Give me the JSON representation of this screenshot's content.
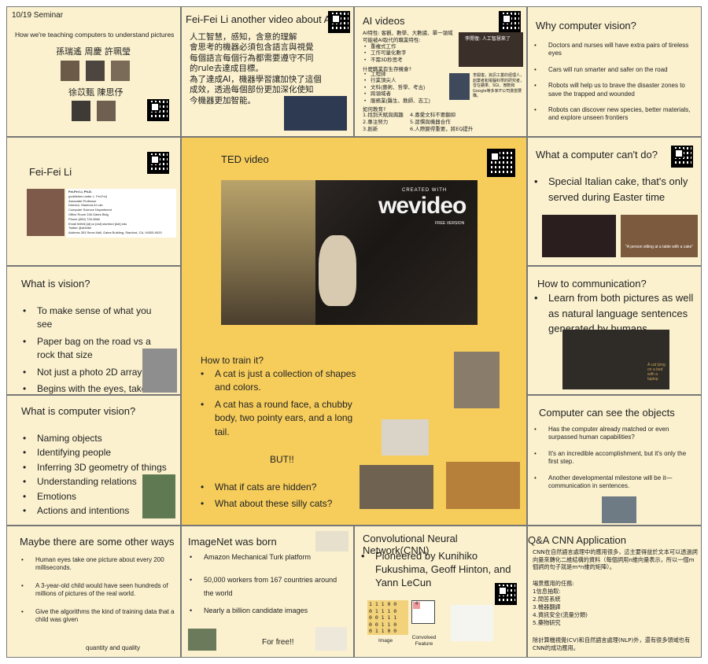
{
  "seminar": {
    "date": "10/19 Seminar",
    "subtitle": "How we're teaching computers to understand pictures",
    "row1": "孫瑞遙  周慶  許珮瑩",
    "row2": "徐苡甄  陳思伃"
  },
  "feifei_video": {
    "title": "Fei-Fei Li another video about AI",
    "text": "人工智慧，感知，含意的理解\n會思考的機器必須包含語言與視覺\n每個語言每個行為都需要遵守不同\n的rule去達成目標。\n為了達成AI，機器學習讓加快了這個\n成效，透過每個部份更加深化使知\n今機器更加智能。"
  },
  "ai_videos": {
    "title": "AI videos",
    "intro": "AI特性: 客觀、數學、大數據、單一領域\n可能被AI取代的職業特性:",
    "list1": [
      "重複式工作",
      "工作可量化數字",
      "不需3D秒思考"
    ],
    "q2": "什麼職業有生存機會?",
    "list2": [
      "工程師",
      "行業頂尖人",
      "文科(藝術、哲學、考古)",
      "跨領域者",
      "服務業(醫生、教師、志工)"
    ],
    "q3": "如何教育?",
    "edu_left": "1.找到天賦與興趣\n2.專注努力\n3.創新",
    "edu_right": "4.喜愛文科不要翻抑\n5.習慣與機器合作\n6.人際變得重要，將EQ提升",
    "caption": "李開復，資訊工業的經理人，創業者和電腦科學的研究者，曾在蘋果、SGI、微軟和Google等多家IT公司擔當要職。",
    "video_title": "李開復: 人工智慧來了"
  },
  "why_cv": {
    "title": "Why computer vision?",
    "items": [
      "Doctors and nurses will have extra pairs of tireless eyes",
      "Cars will run smarter and safer on the road",
      "Robots will help us to brave the disaster zones to save the trapped and wounded",
      "Robots can discover new species, better materials, and explore unseen frontiers"
    ]
  },
  "feifei_li": {
    "title": "Fei-Fei Li",
    "card_rows": [
      "Fei-Fei Li, Ph.D.",
      "(publishes under L. Fei-Fei)",
      "Associate Professor",
      "Director, Stanford AI Lab",
      "Computer Science Department",
      "Office     Room 246 Gates Bldg",
      "Phone      (650) 725-3860",
      "Email      feifeili [at] cs [dot] stanford [dot] edu",
      "Twitter    @drfeifei",
      "Address    353 Serra Mall, Gates Building, Stanford, CA, 94305-9020"
    ]
  },
  "ted": {
    "title": "TED video",
    "watermark": "wevideo",
    "watermark_top": "CREATED WITH",
    "watermark_bottom": "FREE VERSION",
    "train_title": "How to train it?",
    "train_items": [
      "A cat is just a collection of shapes and colors.",
      "A cat has a round face, a chubby body, two pointy ears, and a long tail."
    ],
    "but": "BUT!!",
    "what_items": [
      "What if cats are hidden?",
      "What about these silly cats?"
    ]
  },
  "cant_do": {
    "title": "What a computer can't do?",
    "items": [
      "Special Italian cake, that's only served during Easter time"
    ],
    "caption": "\"A person sitting at a table with a cake\""
  },
  "what_vision": {
    "title": "What is vision?",
    "items": [
      "To make sense of what you see",
      "Paper bag on the road vs a rock that size",
      "Not just a photo 2D array",
      "Begins with the eyes, take place in the brain"
    ]
  },
  "how_comm": {
    "title": "How to communication?",
    "items": [
      "Learn from both pictures as well as natural language sentences generated by humans."
    ],
    "caption": "A cat lying on a bed with a laptop"
  },
  "what_cv": {
    "title": "What is computer vision?",
    "items": [
      "Naming objects",
      "Identifying people",
      "Inferring 3D geometry of things",
      "Understanding relations",
      "Emotions",
      "Actions and intentions"
    ]
  },
  "see_objects": {
    "title": "Computer can see the objects",
    "items": [
      "Has the computer already matched or even surpassed human capabilities?",
      "It's an incredible accomplishment, but it's only the first step.",
      "Another developmental milestone will be it—communication in sentences."
    ]
  },
  "other_ways": {
    "title": "Maybe there are some other ways",
    "items": [
      "Human eyes take one picture about every 200 milliseconds.",
      "A 3-year-old child would have seen hundreds of millions of pictures of the real world.",
      "Give the algorithms the kind of training data that a child was given"
    ],
    "tail": "quantity and quality"
  },
  "imagenet": {
    "title": "ImageNet was born",
    "items": [
      "Amazon Mechanical Turk platform",
      "50,000 workers from 167 countries around the world",
      "Nearly a billion candidate images"
    ],
    "free": "For free!!"
  },
  "cnn": {
    "title": "Convolutional Neural Network(CNN)",
    "items": [
      "Pioneered by Kunihiko Fukushima, Geoff Hinton, and Yann LeCun"
    ],
    "image_label": "Image",
    "feature_label": "Convolved Feature",
    "matrix": [
      "1 1 1 0 0",
      "0 1 1 1 0",
      "0 0 1 1 1",
      "0 0 1 1 0",
      "0 1 1 0 0"
    ],
    "feature_value": "4"
  },
  "qa": {
    "title": "Q&A CNN Application",
    "p1": "CNN在自然語言處理中的應用很多，這主要得益於文本可以透過詞向量來轉化二維結構的資料（每個詞用n維向量表示，所以一個m個詞的句子就是m*n維的矩陣）。",
    "sub": "場景應用的任務:",
    "list": [
      "1信息抽取:",
      "2.問答系統",
      "3.機器翻譯",
      "4.資訊安全(流量分類)",
      "5.藥物研究"
    ],
    "p2": "除計算機視覺(CV)和自然語言處理(NLP)外，還有很多領域也有CNN的成功應用。"
  },
  "colors": {
    "cell_bg": "#fbf1cf",
    "center_bg": "#f6cd5b",
    "border": "#777777"
  }
}
